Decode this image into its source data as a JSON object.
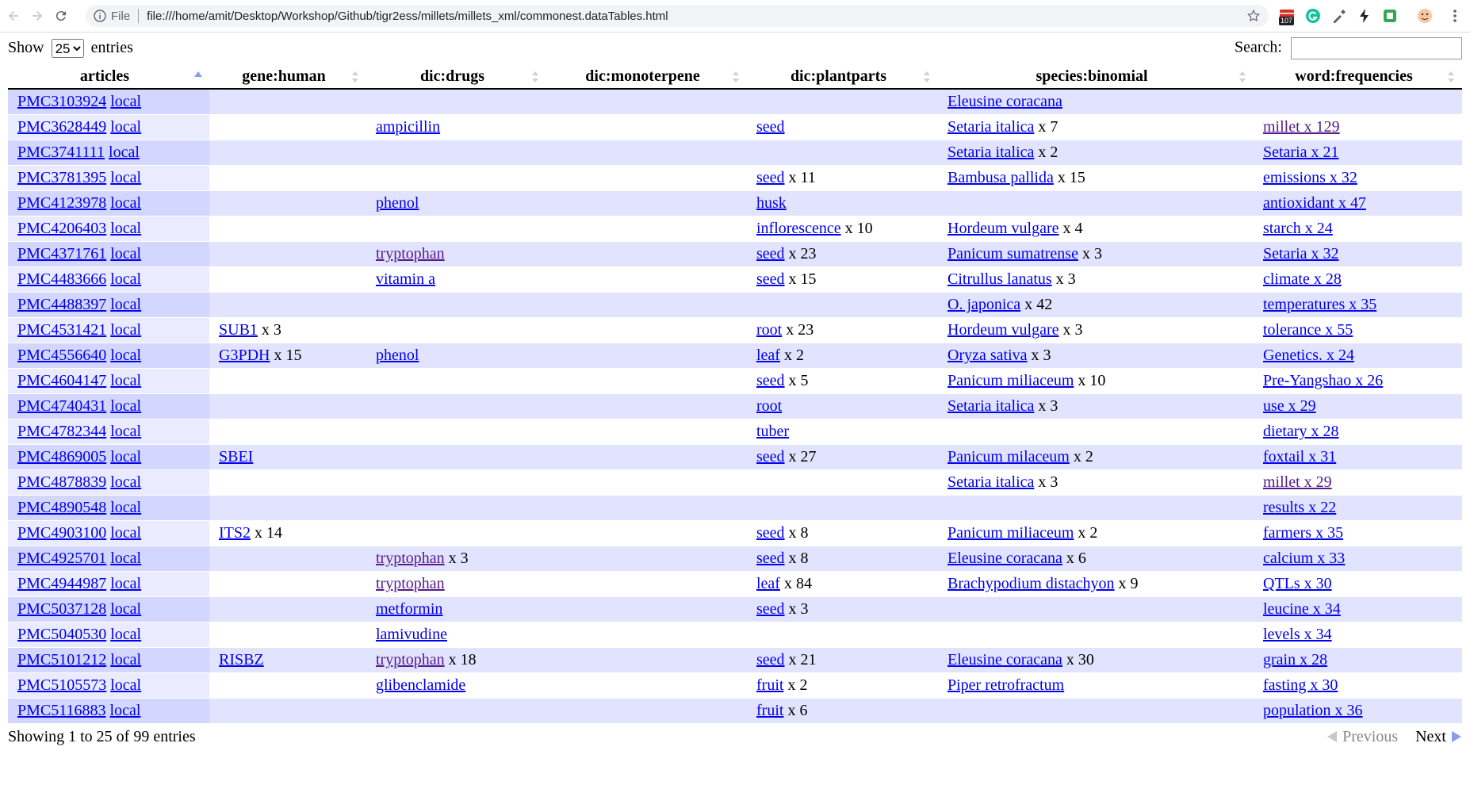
{
  "browser": {
    "scheme": "File",
    "url": "file:///home/amit/Desktop/Workshop/Github/tigr2ess/millets/millets_xml/commonest.dataTables.html",
    "ext_badge": "107"
  },
  "controls": {
    "show_label": "Show",
    "entries_label": "entries",
    "length_value": "25",
    "search_label": "Search:"
  },
  "columns": [
    "articles",
    "gene:human",
    "dic:drugs",
    "dic:monoterpene",
    "dic:plantparts",
    "species:binomial",
    "word:frequencies"
  ],
  "rows": [
    {
      "pmc": "PMC3103924",
      "local": "local",
      "gene": "",
      "gene_n": "",
      "drug": "",
      "drug_n": "",
      "mono": "",
      "part": "",
      "part_n": "",
      "species": "Eleusine coracana",
      "species_n": "",
      "word": ""
    },
    {
      "pmc": "PMC3628449",
      "local": "local",
      "gene": "",
      "gene_n": "",
      "drug": "ampicillin",
      "drug_n": "",
      "mono": "",
      "part": "seed",
      "part_n": "",
      "species": "Setaria italica",
      "species_n": " x 7",
      "word": "millet x 129"
    },
    {
      "pmc": "PMC3741111",
      "local": "local",
      "gene": "",
      "gene_n": "",
      "drug": "",
      "drug_n": "",
      "mono": "",
      "part": "",
      "part_n": "",
      "species": "Setaria italica",
      "species_n": " x 2",
      "word": "Setaria x 21"
    },
    {
      "pmc": "PMC3781395",
      "local": "local",
      "gene": "",
      "gene_n": "",
      "drug": "",
      "drug_n": "",
      "mono": "",
      "part": "seed",
      "part_n": " x 11",
      "species": "Bambusa pallida",
      "species_n": " x 15",
      "word": "emissions x 32"
    },
    {
      "pmc": "PMC4123978",
      "local": "local",
      "gene": "",
      "gene_n": "",
      "drug": "phenol",
      "drug_n": "",
      "mono": "",
      "part": "husk",
      "part_n": "",
      "species": "",
      "species_n": "",
      "word": "antioxidant x 47"
    },
    {
      "pmc": "PMC4206403",
      "local": "local",
      "gene": "",
      "gene_n": "",
      "drug": "",
      "drug_n": "",
      "mono": "",
      "part": "inflorescence",
      "part_n": " x 10",
      "species": "Hordeum vulgare",
      "species_n": " x 4",
      "word": "starch x 24"
    },
    {
      "pmc": "PMC4371761",
      "local": "local",
      "gene": "",
      "gene_n": "",
      "drug": "tryptophan",
      "drug_n": "",
      "mono": "",
      "part": "seed",
      "part_n": " x 23",
      "species": "Panicum sumatrense",
      "species_n": " x 3",
      "word": "Setaria x 32"
    },
    {
      "pmc": "PMC4483666",
      "local": "local",
      "gene": "",
      "gene_n": "",
      "drug": "vitamin a",
      "drug_n": "",
      "mono": "",
      "part": "seed",
      "part_n": " x 15",
      "species": "Citrullus lanatus",
      "species_n": " x 3",
      "word": "climate x 28"
    },
    {
      "pmc": "PMC4488397",
      "local": "local",
      "gene": "",
      "gene_n": "",
      "drug": "",
      "drug_n": "",
      "mono": "",
      "part": "",
      "part_n": "",
      "species": "O. japonica",
      "species_n": " x 42",
      "word": "temperatures x 35"
    },
    {
      "pmc": "PMC4531421",
      "local": "local",
      "gene": "SUB1",
      "gene_n": " x 3",
      "drug": "",
      "drug_n": "",
      "mono": "",
      "part": "root",
      "part_n": " x 23",
      "species": "Hordeum vulgare",
      "species_n": " x 3",
      "word": "tolerance x 55"
    },
    {
      "pmc": "PMC4556640",
      "local": "local",
      "gene": "G3PDH",
      "gene_n": " x 15",
      "drug": "phenol",
      "drug_n": "",
      "mono": "",
      "part": "leaf",
      "part_n": " x 2",
      "species": "Oryza sativa",
      "species_n": " x 3",
      "word": "Genetics. x 24"
    },
    {
      "pmc": "PMC4604147",
      "local": "local",
      "gene": "",
      "gene_n": "",
      "drug": "",
      "drug_n": "",
      "mono": "",
      "part": "seed",
      "part_n": " x 5",
      "species": "Panicum miliaceum",
      "species_n": " x 10",
      "word": "Pre-Yangshao x 26"
    },
    {
      "pmc": "PMC4740431",
      "local": "local",
      "gene": "",
      "gene_n": "",
      "drug": "",
      "drug_n": "",
      "mono": "",
      "part": "root",
      "part_n": "",
      "species": "Setaria italica",
      "species_n": " x 3",
      "word": "use x 29"
    },
    {
      "pmc": "PMC4782344",
      "local": "local",
      "gene": "",
      "gene_n": "",
      "drug": "",
      "drug_n": "",
      "mono": "",
      "part": "tuber",
      "part_n": "",
      "species": "",
      "species_n": "",
      "word": "dietary x 28"
    },
    {
      "pmc": "PMC4869005",
      "local": "local",
      "gene": "SBEI",
      "gene_n": "",
      "drug": "",
      "drug_n": "",
      "mono": "",
      "part": "seed",
      "part_n": " x 27",
      "species": "Panicum milaceum",
      "species_n": " x 2",
      "word": "foxtail x 31"
    },
    {
      "pmc": "PMC4878839",
      "local": "local",
      "gene": "",
      "gene_n": "",
      "drug": "",
      "drug_n": "",
      "mono": "",
      "part": "",
      "part_n": "",
      "species": "Setaria italica",
      "species_n": " x 3",
      "word": "millet x 29"
    },
    {
      "pmc": "PMC4890548",
      "local": "local",
      "gene": "",
      "gene_n": "",
      "drug": "",
      "drug_n": "",
      "mono": "",
      "part": "",
      "part_n": "",
      "species": "",
      "species_n": "",
      "word": "results x 22"
    },
    {
      "pmc": "PMC4903100",
      "local": "local",
      "gene": "ITS2",
      "gene_n": " x 14",
      "drug": "",
      "drug_n": "",
      "mono": "",
      "part": "seed",
      "part_n": " x 8",
      "species": "Panicum miliaceum",
      "species_n": " x 2",
      "word": "farmers x 35"
    },
    {
      "pmc": "PMC4925701",
      "local": "local",
      "gene": "",
      "gene_n": "",
      "drug": "tryptophan",
      "drug_n": " x 3",
      "mono": "",
      "part": "seed",
      "part_n": " x 8",
      "species": "Eleusine coracana",
      "species_n": " x 6",
      "word": "calcium x 33"
    },
    {
      "pmc": "PMC4944987",
      "local": "local",
      "gene": "",
      "gene_n": "",
      "drug": "tryptophan",
      "drug_n": "",
      "mono": "",
      "part": "leaf",
      "part_n": " x 84",
      "species": "Brachypodium distachyon",
      "species_n": " x 9",
      "word": "QTLs x 30"
    },
    {
      "pmc": "PMC5037128",
      "local": "local",
      "gene": "",
      "gene_n": "",
      "drug": "metformin",
      "drug_n": "",
      "mono": "",
      "part": "seed",
      "part_n": " x 3",
      "species": "",
      "species_n": "",
      "word": "leucine x 34"
    },
    {
      "pmc": "PMC5040530",
      "local": "local",
      "gene": "",
      "gene_n": "",
      "drug": "lamivudine",
      "drug_n": "",
      "mono": "",
      "part": "",
      "part_n": "",
      "species": "",
      "species_n": "",
      "word": "levels x 34"
    },
    {
      "pmc": "PMC5101212",
      "local": "local",
      "gene": "RISBZ",
      "gene_n": "",
      "drug": "tryptophan",
      "drug_n": " x 18",
      "mono": "",
      "part": "seed",
      "part_n": " x 21",
      "species": "Eleusine coracana",
      "species_n": " x 30",
      "word": "grain x 28"
    },
    {
      "pmc": "PMC5105573",
      "local": "local",
      "gene": "",
      "gene_n": "",
      "drug": "glibenclamide",
      "drug_n": "",
      "mono": "",
      "part": "fruit",
      "part_n": " x 2",
      "species": "Piper retrofractum",
      "species_n": "",
      "word": "fasting x 30"
    },
    {
      "pmc": "PMC5116883",
      "local": "local",
      "gene": "",
      "gene_n": "",
      "drug": "",
      "drug_n": "",
      "mono": "",
      "part": "fruit",
      "part_n": " x 6",
      "species": "",
      "species_n": "",
      "word": "population x 36"
    }
  ],
  "footer": {
    "info": "Showing 1 to 25 of 99 entries",
    "previous": "Previous",
    "next": "Next"
  },
  "colors": {
    "odd_row": "#e2e4ff",
    "odd_sorted": "#d3d6ff",
    "even_sorted": "#eaebff",
    "link": "#0000ee",
    "visited_link": "#551a8b"
  }
}
